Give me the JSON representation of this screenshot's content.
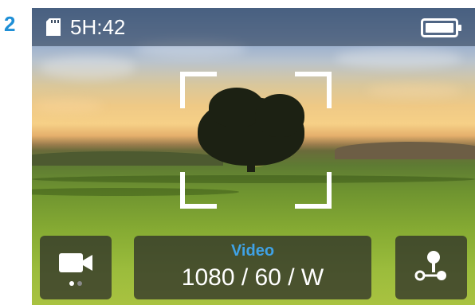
{
  "step": {
    "number": "2"
  },
  "status_bar": {
    "time_remaining": "5H:42",
    "storage_icon": "sd-card-icon",
    "battery_icon": "battery-full-icon"
  },
  "bottom_bar": {
    "mode_icon": "video-camera-icon",
    "mode_label": "Video",
    "settings_value": "1080 / 60 / W",
    "share_icon": "connect-share-icon"
  },
  "colors": {
    "step_number": "#1f8fd6",
    "mode_label": "#3fa2e6",
    "text": "#ffffff",
    "panel": "rgba(40,40,40,0.72)"
  }
}
